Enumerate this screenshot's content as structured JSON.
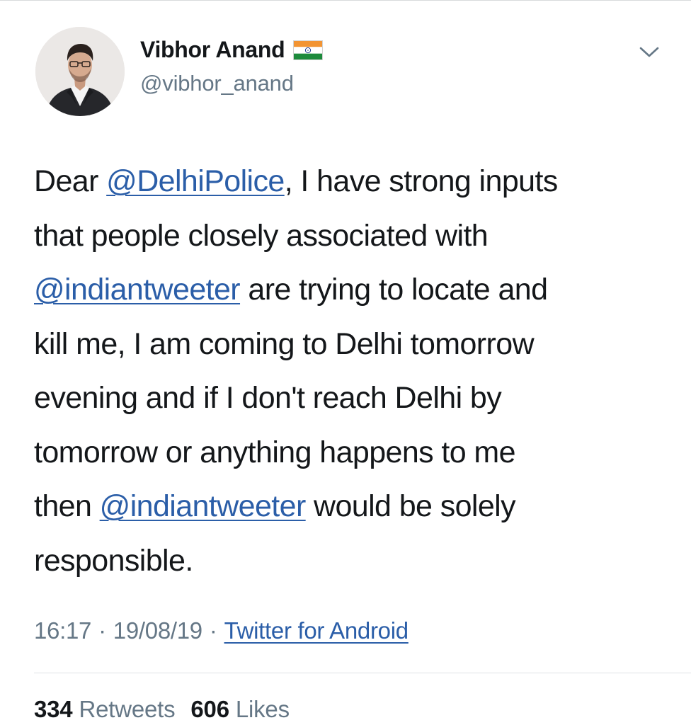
{
  "author": {
    "display_name": "Vibhor Anand",
    "handle": "@vibhor_anand",
    "avatar": "profile-photo",
    "badge_icon": "india-flag-icon"
  },
  "menu": {
    "icon": "chevron-down-icon"
  },
  "tweet": {
    "lines": [
      [
        {
          "text": "Dear "
        },
        {
          "text": "@DelhiPolice",
          "mention": true
        },
        {
          "text": ", I have strong inputs"
        }
      ],
      [
        {
          "text": "that people closely associated with"
        }
      ],
      [
        {
          "text": "@indiantweeter",
          "mention": true
        },
        {
          "text": " are trying to locate and"
        }
      ],
      [
        {
          "text": "kill me, I am coming to Delhi tomorrow"
        }
      ],
      [
        {
          "text": "evening and if I don't reach Delhi by"
        }
      ],
      [
        {
          "text": "tomorrow or anything happens to me"
        }
      ],
      [
        {
          "text": "then "
        },
        {
          "text": "@indiantweeter",
          "mention": true
        },
        {
          "text": " would be solely"
        }
      ],
      [
        {
          "text": "responsible."
        }
      ]
    ]
  },
  "meta": {
    "time": "16:17",
    "separator": "·",
    "date": "19/08/19",
    "source": "Twitter for Android"
  },
  "stats": {
    "retweets_count": "334",
    "retweets_label": "Retweets",
    "likes_count": "606",
    "likes_label": "Likes"
  },
  "colors": {
    "text": "#14171a",
    "secondary": "#657786",
    "link": "#2b5ea8",
    "divider": "#dfe3e6"
  }
}
